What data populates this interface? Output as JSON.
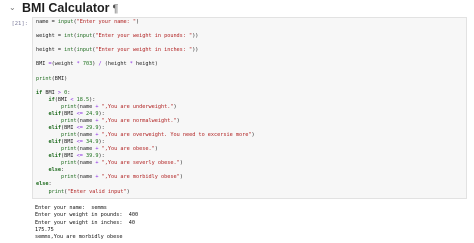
{
  "heading": {
    "title": "BMI Calculator",
    "anchor": "¶"
  },
  "cell": {
    "prompt": "[21]:",
    "source_lines": [
      [
        {
          "t": "name = "
        },
        {
          "t": "input",
          "c": "bi"
        },
        {
          "t": "("
        },
        {
          "t": "\"Enter your name: \"",
          "c": "str"
        },
        {
          "t": ")"
        }
      ],
      [],
      [
        {
          "t": "weight = "
        },
        {
          "t": "int",
          "c": "bi"
        },
        {
          "t": "("
        },
        {
          "t": "input",
          "c": "bi"
        },
        {
          "t": "("
        },
        {
          "t": "\"Enter your weight in pounds: \"",
          "c": "str"
        },
        {
          "t": "))"
        }
      ],
      [],
      [
        {
          "t": "height = "
        },
        {
          "t": "int",
          "c": "bi"
        },
        {
          "t": "("
        },
        {
          "t": "input",
          "c": "bi"
        },
        {
          "t": "("
        },
        {
          "t": "\"Enter your weight in inches: \"",
          "c": "str"
        },
        {
          "t": "))"
        }
      ],
      [],
      [
        {
          "t": "BMI "
        },
        {
          "t": "=",
          "c": "op"
        },
        {
          "t": "(weight "
        },
        {
          "t": "*",
          "c": "op"
        },
        {
          "t": " "
        },
        {
          "t": "703",
          "c": "num"
        },
        {
          "t": ") "
        },
        {
          "t": "/",
          "c": "op"
        },
        {
          "t": " (height "
        },
        {
          "t": "*",
          "c": "op"
        },
        {
          "t": " height)"
        }
      ],
      [],
      [
        {
          "t": "print",
          "c": "bi"
        },
        {
          "t": "(BMI)"
        }
      ],
      [],
      [
        {
          "t": "if",
          "c": "kw"
        },
        {
          "t": " BMI "
        },
        {
          "t": ">",
          "c": "op"
        },
        {
          "t": " "
        },
        {
          "t": "0",
          "c": "num"
        },
        {
          "t": ":"
        }
      ],
      [
        {
          "t": "    "
        },
        {
          "t": "if",
          "c": "kw"
        },
        {
          "t": "(BMI "
        },
        {
          "t": "<",
          "c": "op"
        },
        {
          "t": " "
        },
        {
          "t": "18.5",
          "c": "num"
        },
        {
          "t": "):"
        }
      ],
      [
        {
          "t": "        "
        },
        {
          "t": "print",
          "c": "bi"
        },
        {
          "t": "(name "
        },
        {
          "t": "+",
          "c": "op"
        },
        {
          "t": " "
        },
        {
          "t": "\",You are underweight.\"",
          "c": "str"
        },
        {
          "t": ")"
        }
      ],
      [
        {
          "t": "    "
        },
        {
          "t": "elif",
          "c": "kw"
        },
        {
          "t": "(BMI "
        },
        {
          "t": "<=",
          "c": "op"
        },
        {
          "t": " "
        },
        {
          "t": "24.9",
          "c": "num"
        },
        {
          "t": "):"
        }
      ],
      [
        {
          "t": "        "
        },
        {
          "t": "print",
          "c": "bi"
        },
        {
          "t": "(name "
        },
        {
          "t": "+",
          "c": "op"
        },
        {
          "t": " "
        },
        {
          "t": "\",You are normalweight.\"",
          "c": "str"
        },
        {
          "t": ")"
        }
      ],
      [
        {
          "t": "    "
        },
        {
          "t": "elif",
          "c": "kw"
        },
        {
          "t": "(BMI "
        },
        {
          "t": "<=",
          "c": "op"
        },
        {
          "t": " "
        },
        {
          "t": "29.9",
          "c": "num"
        },
        {
          "t": "):"
        }
      ],
      [
        {
          "t": "        "
        },
        {
          "t": "print",
          "c": "bi"
        },
        {
          "t": "(name "
        },
        {
          "t": "+",
          "c": "op"
        },
        {
          "t": " "
        },
        {
          "t": "\",You are overweight. You need to excersie more\"",
          "c": "str"
        },
        {
          "t": ")"
        }
      ],
      [
        {
          "t": "    "
        },
        {
          "t": "elif",
          "c": "kw"
        },
        {
          "t": "(BMI "
        },
        {
          "t": "<=",
          "c": "op"
        },
        {
          "t": " "
        },
        {
          "t": "34.9",
          "c": "num"
        },
        {
          "t": "):"
        }
      ],
      [
        {
          "t": "        "
        },
        {
          "t": "print",
          "c": "bi"
        },
        {
          "t": "(name "
        },
        {
          "t": "+",
          "c": "op"
        },
        {
          "t": " "
        },
        {
          "t": "\",You are obese.\"",
          "c": "str"
        },
        {
          "t": ")"
        }
      ],
      [
        {
          "t": "    "
        },
        {
          "t": "elif",
          "c": "kw"
        },
        {
          "t": "(BMI "
        },
        {
          "t": "<=",
          "c": "op"
        },
        {
          "t": " "
        },
        {
          "t": "39.9",
          "c": "num"
        },
        {
          "t": "):"
        }
      ],
      [
        {
          "t": "        "
        },
        {
          "t": "print",
          "c": "bi"
        },
        {
          "t": "(name "
        },
        {
          "t": "+",
          "c": "op"
        },
        {
          "t": " "
        },
        {
          "t": "\",You are severly obese.\"",
          "c": "str"
        },
        {
          "t": ")"
        }
      ],
      [
        {
          "t": "    "
        },
        {
          "t": "else",
          "c": "kw"
        },
        {
          "t": ":"
        }
      ],
      [
        {
          "t": "        "
        },
        {
          "t": "print",
          "c": "bi"
        },
        {
          "t": "(name "
        },
        {
          "t": "+",
          "c": "op"
        },
        {
          "t": " "
        },
        {
          "t": "\",You are morbidly obese\"",
          "c": "str"
        },
        {
          "t": ")"
        }
      ],
      [
        {
          "t": "else",
          "c": "kw"
        },
        {
          "t": ":"
        }
      ],
      [
        {
          "t": "    "
        },
        {
          "t": "print",
          "c": "bi"
        },
        {
          "t": "("
        },
        {
          "t": "\"Enter valid input\"",
          "c": "str"
        },
        {
          "t": ")"
        }
      ]
    ],
    "output_lines": [
      "Enter your name:  semms",
      "Enter your weight in pounds:  400",
      "Enter your weight in inches:  40",
      "175.75",
      "semms,You are morbidly obese"
    ]
  }
}
